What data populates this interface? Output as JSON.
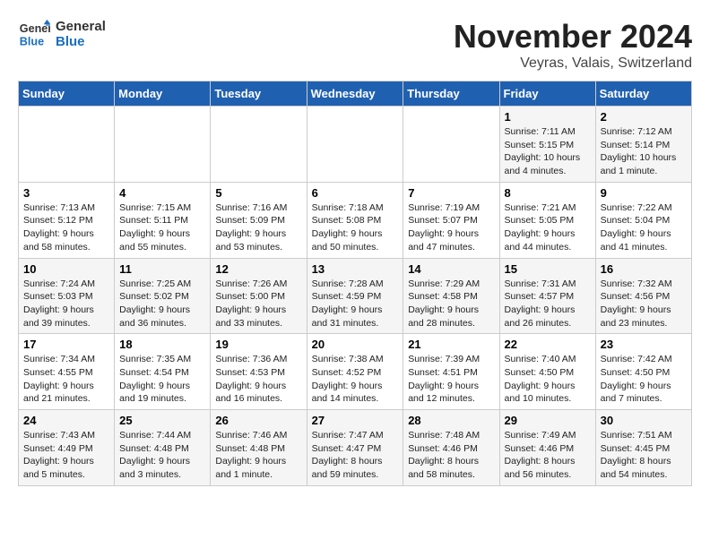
{
  "header": {
    "logo_line1": "General",
    "logo_line2": "Blue",
    "month_title": "November 2024",
    "location": "Veyras, Valais, Switzerland"
  },
  "weekdays": [
    "Sunday",
    "Monday",
    "Tuesday",
    "Wednesday",
    "Thursday",
    "Friday",
    "Saturday"
  ],
  "weeks": [
    [
      {
        "day": "",
        "info": ""
      },
      {
        "day": "",
        "info": ""
      },
      {
        "day": "",
        "info": ""
      },
      {
        "day": "",
        "info": ""
      },
      {
        "day": "",
        "info": ""
      },
      {
        "day": "1",
        "info": "Sunrise: 7:11 AM\nSunset: 5:15 PM\nDaylight: 10 hours\nand 4 minutes."
      },
      {
        "day": "2",
        "info": "Sunrise: 7:12 AM\nSunset: 5:14 PM\nDaylight: 10 hours\nand 1 minute."
      }
    ],
    [
      {
        "day": "3",
        "info": "Sunrise: 7:13 AM\nSunset: 5:12 PM\nDaylight: 9 hours\nand 58 minutes."
      },
      {
        "day": "4",
        "info": "Sunrise: 7:15 AM\nSunset: 5:11 PM\nDaylight: 9 hours\nand 55 minutes."
      },
      {
        "day": "5",
        "info": "Sunrise: 7:16 AM\nSunset: 5:09 PM\nDaylight: 9 hours\nand 53 minutes."
      },
      {
        "day": "6",
        "info": "Sunrise: 7:18 AM\nSunset: 5:08 PM\nDaylight: 9 hours\nand 50 minutes."
      },
      {
        "day": "7",
        "info": "Sunrise: 7:19 AM\nSunset: 5:07 PM\nDaylight: 9 hours\nand 47 minutes."
      },
      {
        "day": "8",
        "info": "Sunrise: 7:21 AM\nSunset: 5:05 PM\nDaylight: 9 hours\nand 44 minutes."
      },
      {
        "day": "9",
        "info": "Sunrise: 7:22 AM\nSunset: 5:04 PM\nDaylight: 9 hours\nand 41 minutes."
      }
    ],
    [
      {
        "day": "10",
        "info": "Sunrise: 7:24 AM\nSunset: 5:03 PM\nDaylight: 9 hours\nand 39 minutes."
      },
      {
        "day": "11",
        "info": "Sunrise: 7:25 AM\nSunset: 5:02 PM\nDaylight: 9 hours\nand 36 minutes."
      },
      {
        "day": "12",
        "info": "Sunrise: 7:26 AM\nSunset: 5:00 PM\nDaylight: 9 hours\nand 33 minutes."
      },
      {
        "day": "13",
        "info": "Sunrise: 7:28 AM\nSunset: 4:59 PM\nDaylight: 9 hours\nand 31 minutes."
      },
      {
        "day": "14",
        "info": "Sunrise: 7:29 AM\nSunset: 4:58 PM\nDaylight: 9 hours\nand 28 minutes."
      },
      {
        "day": "15",
        "info": "Sunrise: 7:31 AM\nSunset: 4:57 PM\nDaylight: 9 hours\nand 26 minutes."
      },
      {
        "day": "16",
        "info": "Sunrise: 7:32 AM\nSunset: 4:56 PM\nDaylight: 9 hours\nand 23 minutes."
      }
    ],
    [
      {
        "day": "17",
        "info": "Sunrise: 7:34 AM\nSunset: 4:55 PM\nDaylight: 9 hours\nand 21 minutes."
      },
      {
        "day": "18",
        "info": "Sunrise: 7:35 AM\nSunset: 4:54 PM\nDaylight: 9 hours\nand 19 minutes."
      },
      {
        "day": "19",
        "info": "Sunrise: 7:36 AM\nSunset: 4:53 PM\nDaylight: 9 hours\nand 16 minutes."
      },
      {
        "day": "20",
        "info": "Sunrise: 7:38 AM\nSunset: 4:52 PM\nDaylight: 9 hours\nand 14 minutes."
      },
      {
        "day": "21",
        "info": "Sunrise: 7:39 AM\nSunset: 4:51 PM\nDaylight: 9 hours\nand 12 minutes."
      },
      {
        "day": "22",
        "info": "Sunrise: 7:40 AM\nSunset: 4:50 PM\nDaylight: 9 hours\nand 10 minutes."
      },
      {
        "day": "23",
        "info": "Sunrise: 7:42 AM\nSunset: 4:50 PM\nDaylight: 9 hours\nand 7 minutes."
      }
    ],
    [
      {
        "day": "24",
        "info": "Sunrise: 7:43 AM\nSunset: 4:49 PM\nDaylight: 9 hours\nand 5 minutes."
      },
      {
        "day": "25",
        "info": "Sunrise: 7:44 AM\nSunset: 4:48 PM\nDaylight: 9 hours\nand 3 minutes."
      },
      {
        "day": "26",
        "info": "Sunrise: 7:46 AM\nSunset: 4:48 PM\nDaylight: 9 hours\nand 1 minute."
      },
      {
        "day": "27",
        "info": "Sunrise: 7:47 AM\nSunset: 4:47 PM\nDaylight: 8 hours\nand 59 minutes."
      },
      {
        "day": "28",
        "info": "Sunrise: 7:48 AM\nSunset: 4:46 PM\nDaylight: 8 hours\nand 58 minutes."
      },
      {
        "day": "29",
        "info": "Sunrise: 7:49 AM\nSunset: 4:46 PM\nDaylight: 8 hours\nand 56 minutes."
      },
      {
        "day": "30",
        "info": "Sunrise: 7:51 AM\nSunset: 4:45 PM\nDaylight: 8 hours\nand 54 minutes."
      }
    ]
  ]
}
